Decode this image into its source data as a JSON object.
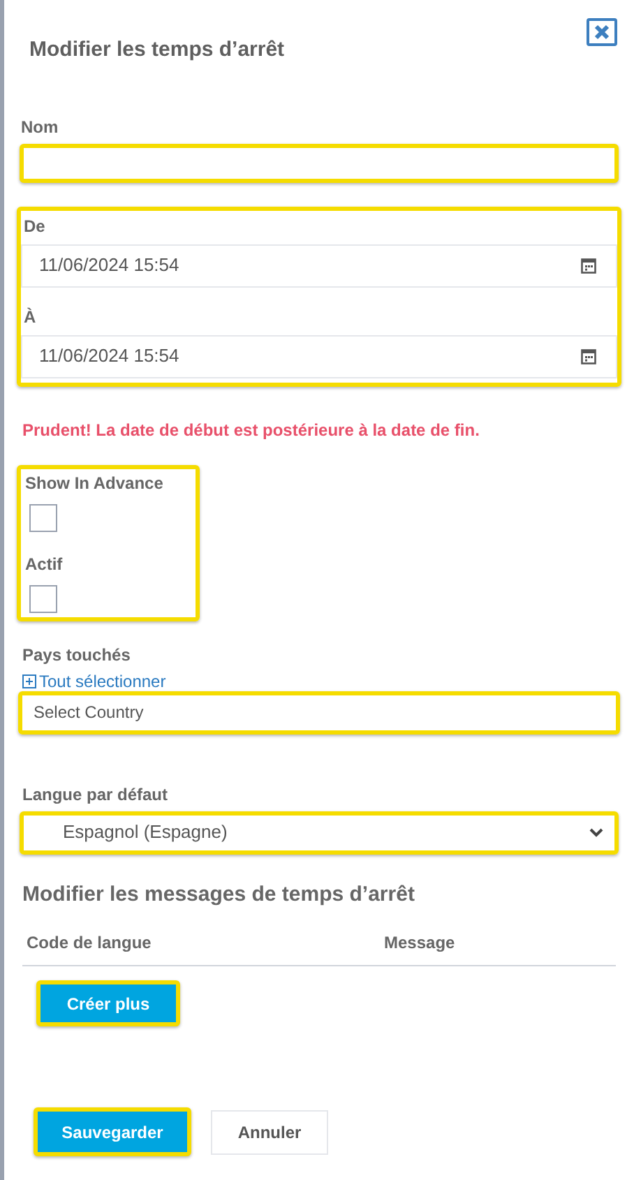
{
  "dialog": {
    "title": "Modifier les temps d’arrêt"
  },
  "name_field": {
    "label": "Nom",
    "highlighted": true
  },
  "date_group": {
    "highlighted": true,
    "fields": [
      {
        "label": "De",
        "value": "11/06/2024 15:54"
      },
      {
        "label": "À",
        "value": "11/06/2024 15:54"
      }
    ]
  },
  "error": "Prudent! La date de début est postérieure à la date de fin.",
  "checkbox_group": {
    "highlighted": true,
    "items": [
      {
        "label": "Show In Advance",
        "checked": false
      },
      {
        "label": "Actif",
        "checked": false
      }
    ]
  },
  "countries": {
    "label": "Pays touchés",
    "select_all": "Tout sélectionner",
    "placeholder": "Select Country",
    "highlighted": true
  },
  "language": {
    "label": "Langue par défaut",
    "value": "Espagnol (Espagne)",
    "highlighted": true
  },
  "messages": {
    "title": "Modifier les messages de temps d’arrêt",
    "columns": [
      "Code de langue",
      "Message"
    ],
    "create_button": {
      "label": "Créer plus",
      "highlighted": true
    }
  },
  "buttons": [
    {
      "label": "Sauvegarder",
      "kind": "primary",
      "highlighted": true
    },
    {
      "label": "Annuler",
      "kind": "secondary",
      "highlighted": false
    }
  ]
}
